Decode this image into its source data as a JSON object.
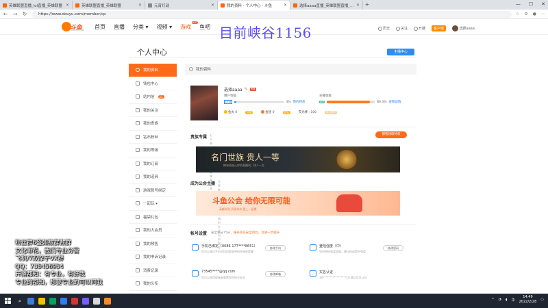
{
  "browser": {
    "tabs": [
      {
        "title": "英雄联盟直播_lol直播_英雄联盟",
        "active": false
      },
      {
        "title": "英雄联盟直播_英雄联盟",
        "active": false
      },
      {
        "title": "元宵灯谜",
        "active": false
      },
      {
        "title": "我的资料 - 个人中心 - 斗鱼",
        "active": true
      },
      {
        "title": "选择aaaa直播_英雄联盟直播_斗鱼",
        "active": false
      }
    ],
    "new_tab": "+",
    "url": "https://www.douyu.com/member/cp"
  },
  "site": {
    "logo_text": "斗鱼",
    "logo_domain": "DOUYU.COM",
    "nav": [
      {
        "label": "首页"
      },
      {
        "label": "直播"
      },
      {
        "label": "分类 ▾"
      },
      {
        "label": "视频 ▾"
      },
      {
        "label": "游戏",
        "badge": "HOT"
      },
      {
        "label": "鱼吧"
      }
    ],
    "header_right": {
      "history": "历史",
      "follow": "关注",
      "broadcast": "开播",
      "client": "客户端",
      "username": "选择aaaa"
    }
  },
  "overlay_title": "目前峡谷1156",
  "page": {
    "title": "个人中心",
    "anchor_center_btn": "主播中心"
  },
  "sidebar": {
    "items": [
      {
        "label": "我的资料",
        "active": true
      },
      {
        "label": "钱包中心"
      },
      {
        "label": "站内信",
        "badge": "21"
      },
      {
        "label": "我的关注"
      },
      {
        "label": "我的贵族"
      },
      {
        "label": "钻石粉丝"
      },
      {
        "label": "我的等级"
      },
      {
        "label": "我的订阅"
      },
      {
        "label": "我的道具"
      },
      {
        "label": "游戏账号绑定"
      },
      {
        "label": "一起玩 ▾"
      },
      {
        "label": "福袋礼包"
      },
      {
        "label": "我的大会员"
      },
      {
        "label": "我的预售"
      },
      {
        "label": "我的申诉记录"
      },
      {
        "label": "消费记录"
      },
      {
        "label": "我的头衔"
      }
    ]
  },
  "profile": {
    "section_title": "我的资料",
    "name": "选择aaaa",
    "level_tag": "贵族",
    "user_level_label": "用户等级",
    "user_level": "LV18",
    "user_level_progress": 4,
    "user_level_pct": "4%",
    "user_level_link": "我的特权",
    "anchor_level_label": "主播等级",
    "anchor_level": "LV7",
    "anchor_level_progress": 89.3,
    "anchor_level_pct": "89.3%",
    "anchor_level_link": "查看详情",
    "fishball": "鱼丸 0",
    "fishball_btn": "充值",
    "fishwing": "鱼翅 0",
    "fishwing_btn": "充值",
    "fans_label": "荧光棒 : 100",
    "badge_btn": "粉丝徽章"
  },
  "noble": {
    "title": "贵族专属",
    "sub": "七大贵族  贵族标识  贵族弹幕  尊享福利",
    "btn": "都我领取特权",
    "banner_title": "名门世族  贵人一等",
    "banner_sub": "拥有贵族让你的直播间，快人一生"
  },
  "guild": {
    "title": "成为公会主播",
    "sub": "专享推荐位  专享活动福利  专业培训指导",
    "banner_title": "斗鱼公会  给你无限可能",
    "banner_sub": "高额补贴  资源扶持  更上一层楼"
  },
  "account": {
    "title": "帐号设置",
    "tip_prefix": "安全评分75分，",
    "tip_highlight": "账号存在安全风险，可进一步提升",
    "items": [
      {
        "title": "手机已绑定（0086 177****8651）",
        "desc": "您可以通过手机号找回登录密码并接收提醒",
        "btn": "修改手机"
      },
      {
        "title": "登陆强度（中）",
        "desc": "您的密码强度较弱，建议修改提升强度",
        "btn": "修改密码"
      },
      {
        "title": "73545****@qq.com",
        "desc": "您可以使用邮箱来重置您的账号安全",
        "btn": "修改邮箱"
      },
      {
        "title": "实名认证",
        "desc": "38*****************2已通过实名认证",
        "btn": ""
      }
    ]
  },
  "stream_overlay": [
    "粉丝群6盛如数群数群",
    "文化嘛花，我们专业分营",
    "飞机/7双摩子VX群",
    "QQ：735456954",
    "开播都知：有专业，有好我",
    "专业的都知，想要专业的可以问我"
  ],
  "taskbar": {
    "time": "14:49",
    "date": "2022/2/28",
    "lang": "中"
  },
  "colors": {
    "brand_orange": "#ff6a1a",
    "link_blue": "#2d8cf0",
    "overlay_purple": "#5a4cff"
  }
}
